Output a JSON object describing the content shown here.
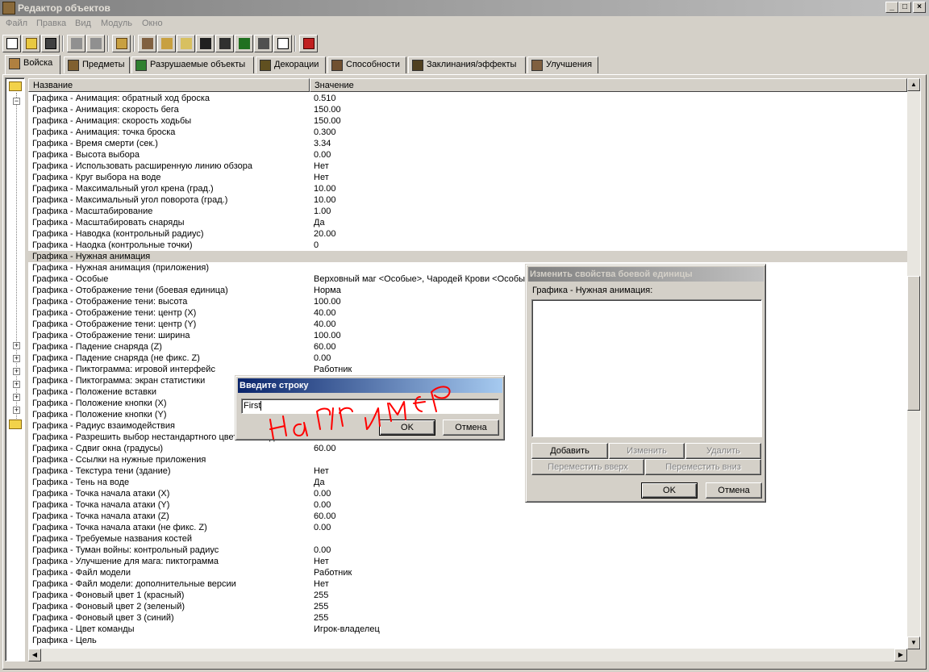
{
  "window": {
    "title": "Редактор объектов",
    "minimize": "_",
    "maximize": "□",
    "close": "×"
  },
  "menu": [
    "Файл",
    "Правка",
    "Вид",
    "Модуль",
    "Окно"
  ],
  "tabs": [
    "Войска",
    "Предметы",
    "Разрушаемые объекты",
    "Декорации",
    "Способности",
    "Заклинания/эффекты",
    "Улучшения"
  ],
  "grid": {
    "columns": [
      "Название",
      "Значение"
    ],
    "rows": [
      [
        "Графика - Анимация: обратный ход броска",
        "0.510"
      ],
      [
        "Графика - Анимация: скорость бега",
        "150.00"
      ],
      [
        "Графика - Анимация: скорость ходьбы",
        "150.00"
      ],
      [
        "Графика - Анимация: точка броска",
        "0.300"
      ],
      [
        "Графика - Время смерти (сек.)",
        "3.34"
      ],
      [
        "Графика - Высота выбора",
        "0.00"
      ],
      [
        "Графика - Использовать расширенную линию обзора",
        "Нет"
      ],
      [
        "Графика - Круг выбора на воде",
        "Нет"
      ],
      [
        "Графика - Максимальный угол крена (град.)",
        "10.00"
      ],
      [
        "Графика - Максимальный угол поворота (град.)",
        "10.00"
      ],
      [
        "Графика - Масштабирование",
        "1.00"
      ],
      [
        "Графика - Масштабировать снаряды",
        "Да"
      ],
      [
        "Графика - Наводка (контрольный радиус)",
        "20.00"
      ],
      [
        "Графика - Наодка (контрольные точки)",
        "0"
      ],
      [
        "Графика - Нужная анимация",
        ""
      ],
      [
        "Графика - Нужная анимация (приложения)",
        ""
      ],
      [
        "Графика - Особые",
        "Верховный маг <Особые>, Чародей Крови <Особые>"
      ],
      [
        "Графика - Отображение тени (боевая единица)",
        "Норма"
      ],
      [
        "Графика - Отображение тени: высота",
        "100.00"
      ],
      [
        "Графика - Отображение тени: центр (X)",
        "40.00"
      ],
      [
        "Графика - Отображение тени: центр (Y)",
        "40.00"
      ],
      [
        "Графика - Отображение тени: ширина",
        "100.00"
      ],
      [
        "Графика - Падение снаряда (Z)",
        "60.00"
      ],
      [
        "Графика - Падение снаряда (не фикс. Z)",
        "0.00"
      ],
      [
        "Графика - Пиктограмма: игровой интерфейс",
        "Работник"
      ],
      [
        "Графика - Пиктограмма: экран статистики",
        ""
      ],
      [
        "Графика - Положение вставки",
        ""
      ],
      [
        "Графика - Положение кнопки (X)",
        ""
      ],
      [
        "Графика - Положение кнопки (Y)",
        ""
      ],
      [
        "Графика - Радиус взаимодействия",
        ""
      ],
      [
        "Графика - Разрешить выбор нестандартного цвета команды",
        "Нет"
      ],
      [
        "Графика - Сдвиг окна (градусы)",
        "60.00"
      ],
      [
        "Графика - Ссылки на нужные приложения",
        ""
      ],
      [
        "Графика - Текстура тени (здание)",
        "Нет"
      ],
      [
        "Графика - Тень на воде",
        "Да"
      ],
      [
        "Графика - Точка начала атаки (X)",
        "0.00"
      ],
      [
        "Графика - Точка начала атаки (Y)",
        "0.00"
      ],
      [
        "Графика - Точка начала атаки (Z)",
        "60.00"
      ],
      [
        "Графика - Точка начала атаки (не фикс. Z)",
        "0.00"
      ],
      [
        "Графика - Требуемые названия костей",
        ""
      ],
      [
        "Графика - Туман войны: контрольный радиус",
        "0.00"
      ],
      [
        "Графика - Улучшение для мага: пиктограмма",
        "Нет"
      ],
      [
        "Графика - Файл модели",
        "Работник"
      ],
      [
        "Графика - Файл модели: дополнительные версии",
        "Нет"
      ],
      [
        "Графика - Фоновый цвет 1 (красный)",
        "255"
      ],
      [
        "Графика - Фоновый цвет 2 (зеленый)",
        "255"
      ],
      [
        "Графика - Фоновый цвет 3 (синий)",
        "255"
      ],
      [
        "Графика - Цвет команды",
        "Игрок-владелец"
      ],
      [
        "Графика - Цель",
        ""
      ]
    ],
    "selected_index": 14
  },
  "props_dialog": {
    "title": "Изменить свойства боевой единицы",
    "label": "Графика - Нужная анимация:",
    "add": "Добавить",
    "edit": "Изменить",
    "delete": "Удалить",
    "move_up": "Переместить вверх",
    "move_down": "Переместить вниз",
    "ok": "OK",
    "cancel": "Отмена"
  },
  "input_dialog": {
    "title": "Введите строку",
    "value": "First",
    "ok": "OK",
    "cancel": "Отмена"
  },
  "annotation": {
    "text": "например",
    "color": "#ff0000"
  },
  "icons": [
    "new-icon",
    "open-icon",
    "save-icon",
    "copy-icon",
    "paste-icon",
    "unit-icon",
    "terrain-icon",
    "sound-icon",
    "ability-icon",
    "object-icon",
    "trigger-icon",
    "ai-icon",
    "import-icon",
    "test-map-icon"
  ]
}
